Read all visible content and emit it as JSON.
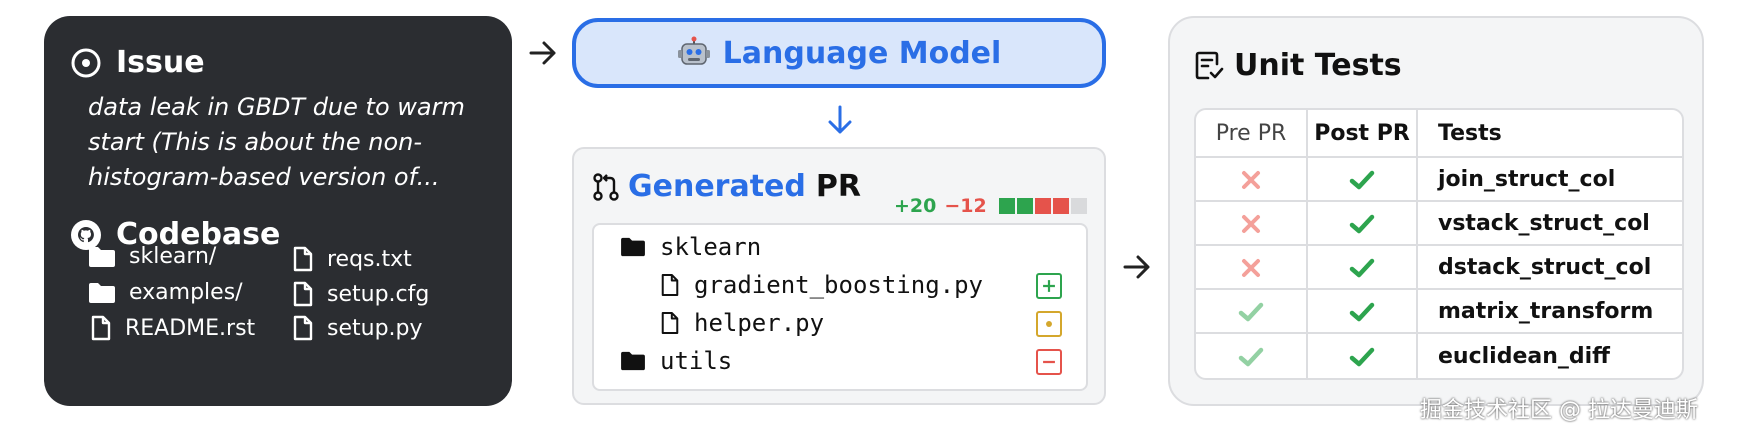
{
  "issue": {
    "title": "Issue",
    "text": "data leak in GBDT due to warm start (This is about the non-histogram-based version of..."
  },
  "codebase": {
    "title": "Codebase",
    "files": [
      {
        "name": "sklearn/",
        "kind": "folder"
      },
      {
        "name": "examples/",
        "kind": "folder"
      },
      {
        "name": "README.rst",
        "kind": "file"
      },
      {
        "name": "reqs.txt",
        "kind": "file"
      },
      {
        "name": "setup.cfg",
        "kind": "file"
      },
      {
        "name": "setup.py",
        "kind": "file"
      }
    ]
  },
  "language_model": {
    "title": "Language Model",
    "icon": "robot-icon"
  },
  "pr": {
    "title_highlight": "Generated",
    "title_rest": "PR",
    "additions": "+20",
    "deletions": "−12",
    "diff_blocks": [
      "#2da44e",
      "#2da44e",
      "#e5534b",
      "#e5534b",
      "#d9dadc"
    ],
    "tree": [
      {
        "name": "sklearn",
        "kind": "folder",
        "indent": 0
      },
      {
        "name": "gradient_boosting.py",
        "kind": "file",
        "indent": 1,
        "status": "added"
      },
      {
        "name": "helper.py",
        "kind": "file",
        "indent": 1,
        "status": "modified"
      },
      {
        "name": "utils",
        "kind": "folder",
        "indent": 0,
        "status": "removed"
      }
    ]
  },
  "unit_tests": {
    "title": "Unit Tests",
    "headers": [
      "Pre PR",
      "Post PR",
      "Tests"
    ],
    "rows": [
      {
        "pre": "fail",
        "post": "pass",
        "name": "join_struct_col"
      },
      {
        "pre": "fail",
        "post": "pass",
        "name": "vstack_struct_col"
      },
      {
        "pre": "fail",
        "post": "pass",
        "name": "dstack_struct_col"
      },
      {
        "pre": "pass",
        "post": "pass",
        "name": "matrix_transform"
      },
      {
        "pre": "pass",
        "post": "pass",
        "name": "euclidean_diff"
      }
    ]
  },
  "colors": {
    "accent_blue": "#2a6ee6",
    "added": "#2da44e",
    "modified": "#d4a72c",
    "removed": "#e5534b",
    "fail_light": "#f4a09a",
    "pass_light": "#93d1a3",
    "pass_dark": "#2da44e"
  },
  "watermark": "掘金技术社区 @ 拉达曼迪斯"
}
